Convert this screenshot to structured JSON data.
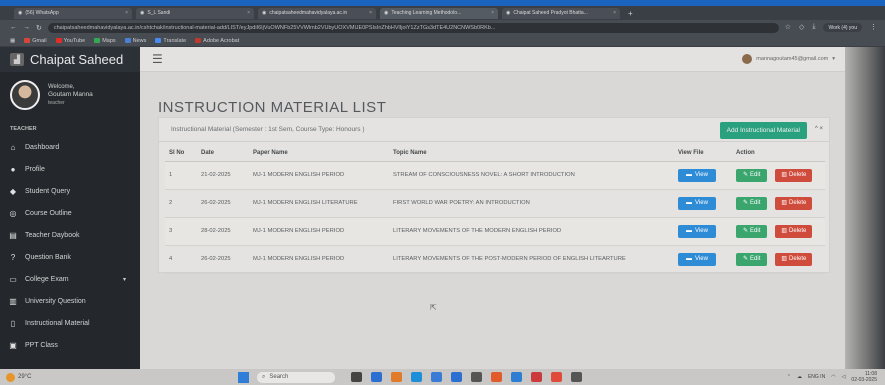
{
  "browser": {
    "tabs": [
      {
        "label": "(56) WhatsApp",
        "active": false
      },
      {
        "label": "S_L Sandi",
        "active": false
      },
      {
        "label": "chaipatsaheedmahavidyalaya.ac.in",
        "active": false
      },
      {
        "label": "Teaching Learning Methodolo...",
        "active": true
      },
      {
        "label": "Chaipat Saheed Pradyot Bhatta...",
        "active": false
      }
    ],
    "new_tab": "+",
    "url": "chaipatsaheedmahavidyalaya.ac.in/cshtchak/instructional-material-add/LIST/eyJpdiI6IjVuOWNFb25VVWlmb2VUbyUOXVMUE0PSIsInZhbHVlIjoiY1ZzTGs3dTE4U2NCNWSb0RKb...",
    "work_label": "Work (4) you",
    "bookmarks": [
      {
        "label": "Gmail",
        "color": "#d44638"
      },
      {
        "label": "YouTube",
        "color": "#e52d27"
      },
      {
        "label": "Maps",
        "color": "#34a853"
      },
      {
        "label": "News",
        "color": "#4a7fd4"
      },
      {
        "label": "Translate",
        "color": "#4a8af4"
      },
      {
        "label": "Adobe Acrobat",
        "color": "#c0392b"
      }
    ]
  },
  "sidebar": {
    "brand": "Chaipat Saheed",
    "welcome": "Welcome,",
    "user_name": "Goutam Manna",
    "user_role": "teacher",
    "section": "TEACHER",
    "items": [
      {
        "icon": "home-icon",
        "glyph": "⌂",
        "label": "Dashboard"
      },
      {
        "icon": "user-icon",
        "glyph": "●",
        "label": "Profile"
      },
      {
        "icon": "graduation-cap-icon",
        "glyph": "◆",
        "label": "Student Query"
      },
      {
        "icon": "target-icon",
        "glyph": "◎",
        "label": "Course Outline"
      },
      {
        "icon": "book-icon",
        "glyph": "▤",
        "label": "Teacher Daybook"
      },
      {
        "icon": "question-icon",
        "glyph": "?",
        "label": "Question Bank"
      },
      {
        "icon": "laptop-icon",
        "glyph": "▭",
        "label": "College Exam"
      },
      {
        "icon": "bank-icon",
        "glyph": "▥",
        "label": "University Question"
      },
      {
        "icon": "file-icon",
        "glyph": "▯",
        "label": "Instructional Material"
      },
      {
        "icon": "ppt-icon",
        "glyph": "▣",
        "label": "PPT Class"
      }
    ]
  },
  "header": {
    "account": "mannagoutam45@gmail.com"
  },
  "page": {
    "title": "INSTRUCTION MATERIAL LIST",
    "panel_title": "Instructional Material (Semester : 1st Sem, Course Type: Honours )",
    "add_button": "Add Instructional Material",
    "panel_controls": "^ ×"
  },
  "table": {
    "columns": [
      "Sl No",
      "Date",
      "Paper Name",
      "Topic Name",
      "View File",
      "Action"
    ],
    "view_label": "View",
    "edit_label": "Edit",
    "delete_label": "Delete",
    "rows": [
      {
        "sl": "1",
        "date": "21-02-2025",
        "paper": "MJ-1 MODERN ENGLISH PERIOD",
        "topic": "STREAM OF CONSCIOUSNESS NOVEL: A SHORT INTRODUCTION"
      },
      {
        "sl": "2",
        "date": "26-02-2025",
        "paper": "MJ-1 MODERN ENGLISH LITERATURE",
        "topic": "FIRST WORLD WAR POETRY: AN INTRODUCTION"
      },
      {
        "sl": "3",
        "date": "28-02-2025",
        "paper": "MJ-1 MODERN ENGLISH PERIOD",
        "topic": "LITERARY MOVEMENTS OF THE MODERN ENGLISH PERIOD"
      },
      {
        "sl": "4",
        "date": "26-02-2025",
        "paper": "MJ-1 MODERN ENGLISH PERIOD",
        "topic": "LITERARY MOVEMENTS OF THE POST-MODERN PERIOD OF ENGLISH LITEARTURE"
      }
    ]
  },
  "taskbar": {
    "weather": "29°C",
    "search": "Search",
    "lang": "ENG IN",
    "time": "11:08",
    "date": "02-03-2025",
    "app_colors": [
      "#444",
      "#2b6fd0",
      "#e07b2c",
      "#1c8fd8",
      "#3a7bd5",
      "#2b6fd0",
      "#555",
      "#e25b2a",
      "#2d7dd2",
      "#cc3b3b",
      "#e04a3a",
      "#555"
    ]
  }
}
